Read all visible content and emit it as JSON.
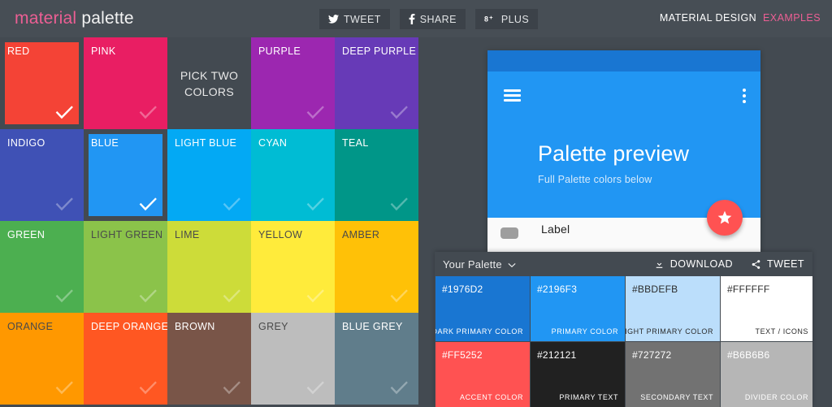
{
  "header": {
    "brand_first": "material",
    "brand_second": "palette",
    "social": [
      {
        "label": "TWEET",
        "icon": "twitter-icon"
      },
      {
        "label": "SHARE",
        "icon": "facebook-icon"
      },
      {
        "label": "PLUS",
        "icon": "googleplus-icon"
      }
    ],
    "right_primary": "MATERIAL DESIGN",
    "right_accent": "EXAMPLES"
  },
  "grid": {
    "message": "PICK TWO\nCOLORS",
    "message_line1": "PICK TWO",
    "message_line2": "COLORS",
    "tiles": [
      {
        "name": "RED",
        "color": "#F44336",
        "selected": true,
        "dark_text": false
      },
      {
        "name": "PINK",
        "color": "#E91E63",
        "selected": false,
        "dark_text": false
      },
      {
        "name": "",
        "color": "#434A51",
        "message": true
      },
      {
        "name": "PURPLE",
        "color": "#9C27B0",
        "selected": false,
        "dark_text": false
      },
      {
        "name": "DEEP PURPLE",
        "color": "#673AB7",
        "selected": false,
        "dark_text": false
      },
      {
        "name": "INDIGO",
        "color": "#3F51B5",
        "selected": false,
        "dark_text": false
      },
      {
        "name": "BLUE",
        "color": "#2196F3",
        "selected": true,
        "dark_text": false
      },
      {
        "name": "LIGHT BLUE",
        "color": "#03A9F4",
        "selected": false,
        "dark_text": false
      },
      {
        "name": "CYAN",
        "color": "#00BCD4",
        "selected": false,
        "dark_text": false
      },
      {
        "name": "TEAL",
        "color": "#009688",
        "selected": false,
        "dark_text": false
      },
      {
        "name": "GREEN",
        "color": "#4CAF50",
        "selected": false,
        "dark_text": false
      },
      {
        "name": "LIGHT GREEN",
        "color": "#8BC34A",
        "selected": false,
        "dark_text": true
      },
      {
        "name": "LIME",
        "color": "#CDDC39",
        "selected": false,
        "dark_text": true
      },
      {
        "name": "YELLOW",
        "color": "#FFEB3B",
        "selected": false,
        "dark_text": true
      },
      {
        "name": "AMBER",
        "color": "#FFC107",
        "selected": false,
        "dark_text": true
      },
      {
        "name": "ORANGE",
        "color": "#FF9800",
        "selected": false,
        "dark_text": true
      },
      {
        "name": "DEEP ORANGE",
        "color": "#FF5722",
        "selected": false,
        "dark_text": false
      },
      {
        "name": "BROWN",
        "color": "#795548",
        "selected": false,
        "dark_text": false
      },
      {
        "name": "GREY",
        "color": "#BDBDBD",
        "selected": false,
        "dark_text": true
      },
      {
        "name": "BLUE GREY",
        "color": "#607D8B",
        "selected": false,
        "dark_text": false
      }
    ]
  },
  "preview": {
    "status_bar_color": "#1976D2",
    "app_bar_color": "#2196F3",
    "title": "Palette preview",
    "subtitle": "Full Palette colors below",
    "fab_color": "#FF5252",
    "fab_icon": "star-icon",
    "menu_icon": "hamburger-icon",
    "overflow_icon": "more-vertical-icon",
    "list_item_label": "Label"
  },
  "palette_panel": {
    "title": "Your Palette",
    "caret": "⌄",
    "download_label": "DOWNLOAD",
    "tweet_label": "TWEET",
    "swatches": [
      {
        "hex": "#1976D2",
        "role": "DARK PRIMARY COLOR",
        "dark_text": false
      },
      {
        "hex": "#2196F3",
        "role": "PRIMARY COLOR",
        "dark_text": false
      },
      {
        "hex": "#BBDEFB",
        "role": "LIGHT PRIMARY COLOR",
        "dark_text": true
      },
      {
        "hex": "#FFFFFF",
        "role": "TEXT / ICONS",
        "dark_text": true
      },
      {
        "hex": "#FF5252",
        "role": "ACCENT COLOR",
        "dark_text": false
      },
      {
        "hex": "#212121",
        "role": "PRIMARY TEXT",
        "dark_text": false
      },
      {
        "hex": "#727272",
        "role": "SECONDARY TEXT",
        "dark_text": false
      },
      {
        "hex": "#B6B6B6",
        "role": "DIVIDER COLOR",
        "dark_text": false
      }
    ]
  }
}
